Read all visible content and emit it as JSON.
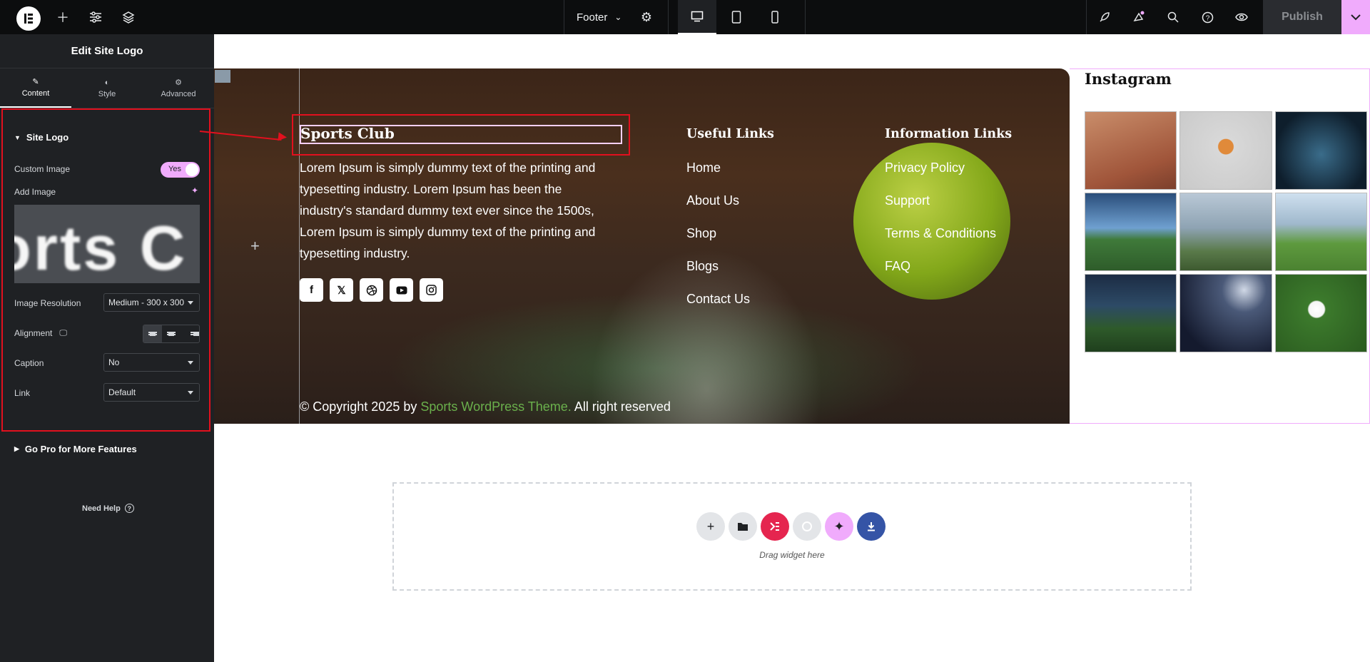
{
  "topbar": {
    "document_name": "Footer",
    "publish_label": "Publish"
  },
  "panel": {
    "title": "Edit Site Logo",
    "tabs": [
      {
        "label": "Content",
        "icon": "pencil-icon"
      },
      {
        "label": "Style",
        "icon": "half-circle-icon"
      },
      {
        "label": "Advanced",
        "icon": "gear-icon"
      }
    ],
    "section_title": "Site Logo",
    "custom_image_label": "Custom Image",
    "custom_image_toggle": "Yes",
    "add_image_label": "Add Image",
    "preview_text": "orts C",
    "image_resolution_label": "Image Resolution",
    "image_resolution_value": "Medium - 300 x 300",
    "alignment_label": "Alignment",
    "caption_label": "Caption",
    "caption_value": "No",
    "link_label": "Link",
    "link_value": "Default",
    "pro_section": "Go Pro for More Features",
    "need_help": "Need Help"
  },
  "footer": {
    "site_logo": "Sports Club",
    "description": "Lorem Ipsum is simply dummy text of the printing and typesetting industry. Lorem Ipsum has been the industry's standard dummy text ever since the 1500s, Lorem Ipsum is simply dummy text of the printing and typesetting industry.",
    "socials": [
      "facebook-icon",
      "x-icon",
      "dribbble-icon",
      "youtube-icon",
      "instagram-icon"
    ],
    "useful_links_title": "Useful Links",
    "useful_links": [
      "Home",
      "About Us",
      "Shop",
      "Blogs",
      "Contact Us"
    ],
    "info_links_title": "Information Links",
    "info_links": [
      "Privacy Policy",
      "Support",
      "Terms & Conditions",
      "FAQ"
    ],
    "copyright_prefix": "© Copyright 2025 by",
    "copyright_link": "Sports WordPress Theme.",
    "copyright_suffix": "All right reserved"
  },
  "instagram": {
    "title": "Instagram"
  },
  "dropzone": {
    "text": "Drag widget here"
  },
  "colors": {
    "accent": "#f0abfc",
    "annotation": "#e2101e",
    "link_green": "#6ab04c",
    "panel_bg": "#1f2124"
  }
}
